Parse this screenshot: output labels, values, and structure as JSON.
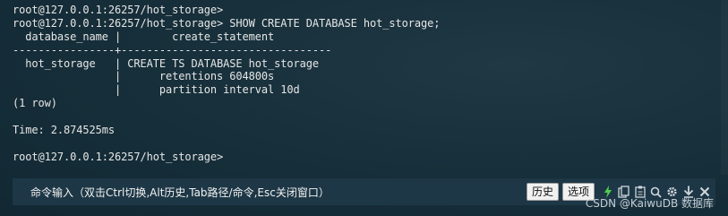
{
  "terminal": {
    "lines": [
      "root@127.0.0.1:26257/hot_storage>",
      "root@127.0.0.1:26257/hot_storage> SHOW CREATE DATABASE hot_storage;",
      "  database_name |        create_statement",
      "----------------+---------------------------------",
      "  hot_storage   | CREATE TS DATABASE hot_storage",
      "                |      retentions 604800s",
      "                |      partition interval 10d",
      "(1 row)",
      "",
      "Time: 2.874525ms",
      "",
      "root@127.0.0.1:26257/hot_storage>"
    ]
  },
  "cmdbar": {
    "hint": "命令输入（双击Ctrl切换,Alt历史,Tab路径/命令,Esc关闭窗口）",
    "history_label": "历史",
    "options_label": "选项"
  },
  "icons": [
    "lightning-icon",
    "copy-icon",
    "clipboard-icon",
    "search-icon",
    "gear-icon",
    "download-icon",
    "close-icon"
  ],
  "colors": {
    "background": "#17303b",
    "cmdbar": "#1d3746",
    "lightning": "#4fd14f"
  },
  "watermark": "CSDN @KaiwuDB 数据库"
}
